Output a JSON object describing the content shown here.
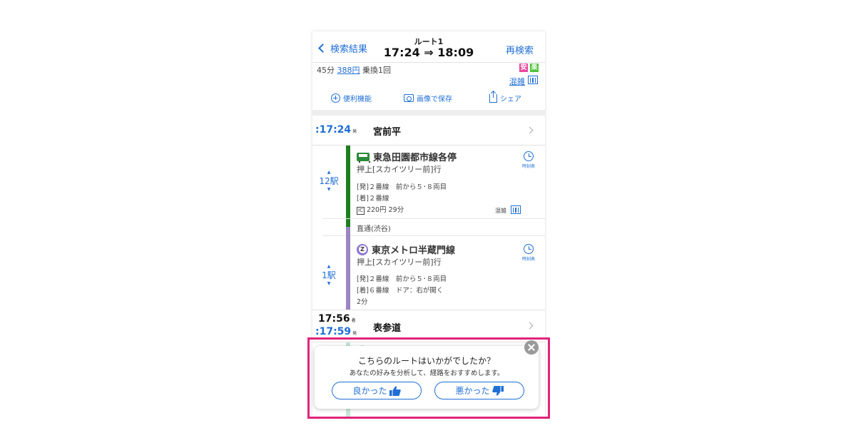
{
  "header": {
    "back_label": "検索結果",
    "route_label": "ルート1",
    "time_range": "17:24 ⇒ 18:09",
    "research_label": "再検索"
  },
  "summary": {
    "duration": "45分",
    "fare": "388円",
    "transfers": "乗換1回",
    "badge_cheap": "安",
    "badge_easy": "楽",
    "congestion_link": "混雑"
  },
  "tools": {
    "useful": "便利機能",
    "save_image": "画像で保存",
    "share": "シェア"
  },
  "stations": [
    {
      "dep_time": ":17:24",
      "dep_suffix": "発",
      "name": "宮前平"
    },
    {
      "arr_time": "17:56",
      "arr_suffix": "着",
      "dep_time": ":17:59",
      "dep_suffix": "発",
      "name": "表参道"
    }
  ],
  "segments": [
    {
      "line": "東急田園都市線各停",
      "destination": "押上[スカイツリー前]行",
      "stops": "12駅",
      "info1": "[発]２番線　前から５･８両目",
      "info2": "[着]２番線",
      "ic_label": "IC",
      "fare_time": "220円 29分",
      "timetable": "時刻表",
      "congestion": "混雑",
      "color": "#1e7f1e"
    },
    {
      "line": "東京メトロ半蔵門線",
      "destination": "押上[スカイツリー前]行",
      "stops": "1駅",
      "info1": "[発]２番線　前から５･８両目",
      "info2": "[着]６番線　ドア：右が開く",
      "minutes": "2分",
      "timetable": "時刻表",
      "icon_letter": "Z",
      "color": "#9b86c2"
    }
  ],
  "through_service": "直通(渋谷)",
  "popup": {
    "question": "こちらのルートはいかがでしたか？",
    "subtitle": "あなたの好みを分析して、経路をおすすめします。",
    "good_label": "良かった",
    "bad_label": "悪かった"
  },
  "colors": {
    "accent": "#1f6fd6",
    "highlight": "#e0247a",
    "den_en_toshi": "#1e7f1e",
    "hanzomon": "#9b86c2",
    "ginza_next": "#1ea865"
  }
}
